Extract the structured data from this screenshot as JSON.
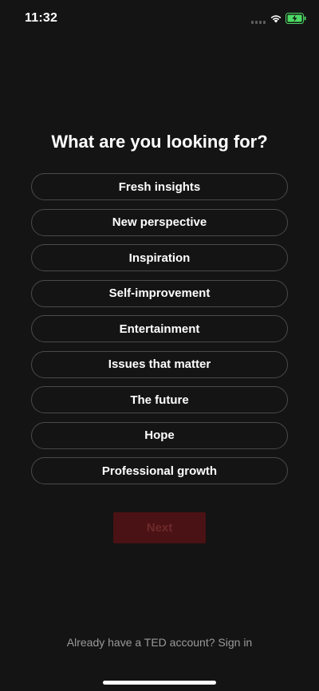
{
  "status_bar": {
    "time": "11:32",
    "signal_icon": "cellular-signal-icon",
    "wifi_icon": "wifi-icon",
    "battery_icon": "battery-charging-icon",
    "battery_color": "#4cd964"
  },
  "title": "What are you looking for?",
  "options": [
    {
      "label": "Fresh insights"
    },
    {
      "label": "New perspective"
    },
    {
      "label": "Inspiration"
    },
    {
      "label": "Self-improvement"
    },
    {
      "label": "Entertainment"
    },
    {
      "label": "Issues that matter"
    },
    {
      "label": "The future"
    },
    {
      "label": "Hope"
    },
    {
      "label": "Professional growth"
    }
  ],
  "next_button": {
    "label": "Next",
    "disabled": true,
    "color": "#4a1214"
  },
  "signin": {
    "prompt": "Already have a TED account?",
    "link": "Sign in"
  },
  "colors": {
    "background": "#141414",
    "option_border": "#4a4a4a",
    "muted_text": "#9a9a9a"
  }
}
